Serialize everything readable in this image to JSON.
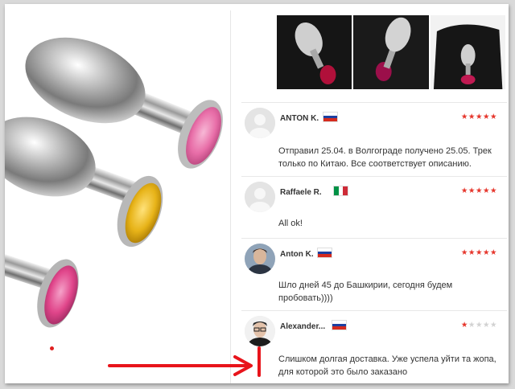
{
  "gallery": {
    "active_dot_color": "#e02020",
    "gem_colors": [
      "#e86ea8",
      "#e7b318",
      "#e0458a"
    ]
  },
  "thumbnails": [
    {
      "gem_color": "#b0103a"
    },
    {
      "gem_color": "#9b0f4a"
    },
    {
      "gem_color": "#c01a52"
    }
  ],
  "reviews": [
    {
      "name": "ANTON K.",
      "country": "ru",
      "rating": 5,
      "stars_on": "★★★★★",
      "stars_off": "",
      "avatar": "placeholder",
      "text_lines": [
        "Отправил 25.04. в Волгограде получено 25.05. Трек",
        "только по Китаю. Все соответствует описанию."
      ]
    },
    {
      "name": "Raffaele R.",
      "country": "it",
      "rating": 5,
      "stars_on": "★★★★★",
      "stars_off": "",
      "avatar": "placeholder",
      "text_lines": [
        "All ok!"
      ]
    },
    {
      "name": "Anton K.",
      "country": "ru",
      "rating": 5,
      "stars_on": "★★★★★",
      "stars_off": "",
      "avatar": "photo",
      "text_lines": [
        "Шло дней 45 до Башкирии, сегодня будем",
        "пробовать))))"
      ]
    },
    {
      "name": "Alexander...",
      "country": "ru",
      "rating": 1,
      "stars_on": "★",
      "stars_off": "★★★★",
      "avatar": "photo",
      "text_lines": [
        "Слишком долгая доставка. Уже успела уйти та жопа,",
        "для которой это было заказано"
      ]
    }
  ],
  "colors": {
    "star_active": "#e6352b",
    "star_inactive": "#d2d2d2",
    "annotation_arrow": "#e8141b",
    "flag_ru": [
      "#ffffff",
      "#1c3fa0",
      "#d52b1e"
    ],
    "flag_it": [
      "#009246",
      "#ffffff",
      "#ce2b37"
    ]
  }
}
